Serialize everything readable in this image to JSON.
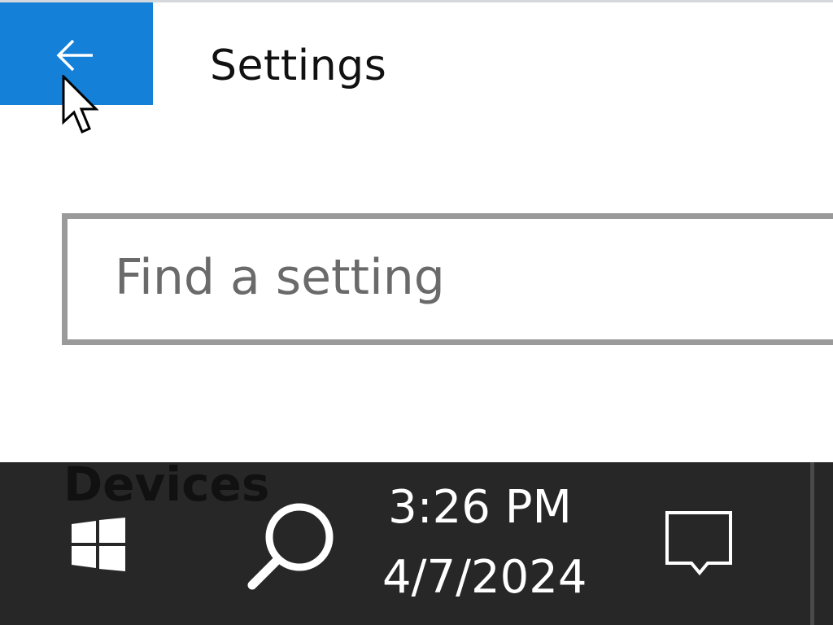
{
  "window": {
    "title": "Settings",
    "back_icon": "arrow-left-icon"
  },
  "search": {
    "placeholder": "Find a setting"
  },
  "section": {
    "partial_label": "Devices"
  },
  "taskbar": {
    "start_icon": "windows-logo-icon",
    "search_icon": "search-icon",
    "time": "3:26 PM",
    "date": "4/7/2024",
    "notification_icon": "action-center-icon"
  },
  "colors": {
    "accent": "#1480d8",
    "taskbar_bg": "#272727",
    "search_border": "#9a9a9a",
    "placeholder_text": "#6a6a6a"
  }
}
